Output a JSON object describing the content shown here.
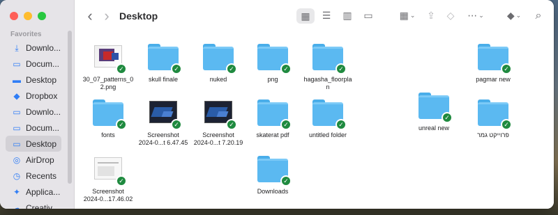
{
  "window": {
    "title": "Desktop"
  },
  "sidebar": {
    "section_label": "Favorites",
    "items": [
      {
        "label": "Downlo...",
        "icon": "download-circle-icon",
        "glyph": "⤓"
      },
      {
        "label": "Docum...",
        "icon": "document-icon",
        "glyph": "▭"
      },
      {
        "label": "Desktop",
        "icon": "desktop-icon",
        "glyph": "▬"
      },
      {
        "label": "Dropbox",
        "icon": "dropbox-icon",
        "glyph": "◆"
      },
      {
        "label": "Downlo...",
        "icon": "folder-icon",
        "glyph": "▭"
      },
      {
        "label": "Docum...",
        "icon": "folder-icon",
        "glyph": "▭"
      },
      {
        "label": "Desktop",
        "icon": "folder-icon",
        "glyph": "▭"
      },
      {
        "label": "AirDrop",
        "icon": "airdrop-icon",
        "glyph": "◎"
      },
      {
        "label": "Recents",
        "icon": "clock-icon",
        "glyph": "◷"
      },
      {
        "label": "Applica...",
        "icon": "applications-icon",
        "glyph": "✦"
      },
      {
        "label": "Creativ...",
        "icon": "cloud-icon",
        "glyph": "☁"
      }
    ],
    "active_index": 6
  },
  "toolbar": {
    "back_glyph": "‹",
    "forward_glyph": "›",
    "view_icons": "▦",
    "view_list": "☰",
    "view_columns": "▥",
    "view_gallery": "▭",
    "group_glyph": "▦",
    "share_glyph": "⇪",
    "tag_glyph": "◇",
    "more_glyph": "⋯",
    "dropbox_glyph": "◆",
    "search_glyph": "⌕",
    "chevron": "⌄"
  },
  "files": [
    {
      "name": "30_07_patterns_0\n2.png",
      "kind": "image-patterns"
    },
    {
      "name": "skull finale",
      "kind": "folder"
    },
    {
      "name": "nuked",
      "kind": "folder"
    },
    {
      "name": "png",
      "kind": "folder"
    },
    {
      "name": "hagasha_floorpla\nn",
      "kind": "folder"
    },
    {
      "name": "pagmar new",
      "kind": "folder"
    },
    {
      "name": "fonts",
      "kind": "folder"
    },
    {
      "name": "Screenshot\n2024-0...t 6.47.45",
      "kind": "image-shot"
    },
    {
      "name": "Screenshot\n2024-0...t 7.20.19",
      "kind": "image-shot"
    },
    {
      "name": "skaterat pdf",
      "kind": "folder"
    },
    {
      "name": "untitled folder",
      "kind": "folder"
    },
    {
      "name": "unreal new",
      "kind": "folder"
    },
    {
      "name": "פרוייקט גמר",
      "kind": "folder"
    },
    {
      "name": "Screenshot\n2024-0...17.46.02",
      "kind": "image-white"
    },
    {
      "name": "Downloads",
      "kind": "folder"
    }
  ],
  "sync_glyph": "✓",
  "colors": {
    "folder": "#5bb9f1",
    "sync_badge": "#1f8a3f",
    "accent": "#2f7df6"
  }
}
